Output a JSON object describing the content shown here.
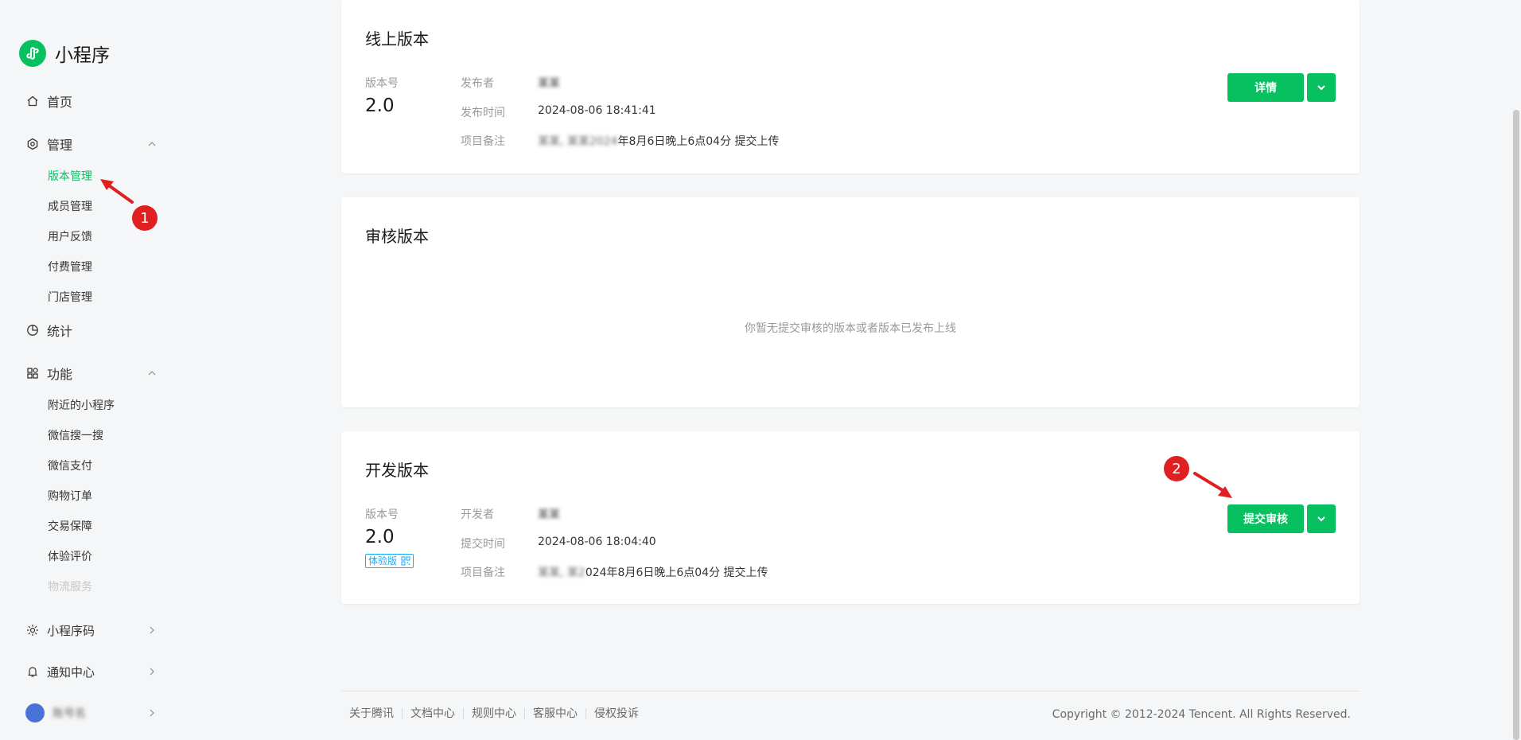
{
  "app": {
    "title": "小程序"
  },
  "sidebar": {
    "home": "首页",
    "manage": {
      "label": "管理",
      "items": [
        "版本管理",
        "成员管理",
        "用户反馈",
        "付费管理",
        "门店管理"
      ]
    },
    "stats": "统计",
    "features": {
      "label": "功能",
      "items": [
        "附近的小程序",
        "微信搜一搜",
        "微信支付",
        "购物订单",
        "交易保障",
        "体验评价",
        "物流服务"
      ]
    },
    "qrcode": "小程序码",
    "notify": "通知中心",
    "account_name": "账号名"
  },
  "online": {
    "title": "线上版本",
    "version_label": "版本号",
    "version": "2.0",
    "publisher_label": "发布者",
    "publisher": "某某",
    "time_label": "发布时间",
    "time": "2024-08-06 18:41:41",
    "note_label": "项目备注",
    "note_blur": "某某, 某某2024",
    "note_text": "年8月6日晚上6点04分 提交上传",
    "detail_button": "详情"
  },
  "review": {
    "title": "审核版本",
    "empty": "你暂无提交审核的版本或者版本已发布上线"
  },
  "dev": {
    "title": "开发版本",
    "version_label": "版本号",
    "version": "2.0",
    "badge": "体验版",
    "developer_label": "开发者",
    "developer": "某某",
    "time_label": "提交时间",
    "time": "2024-08-06 18:04:40",
    "note_label": "项目备注",
    "note_blur": "某某, 某2",
    "note_text": "024年8月6日晚上6点04分 提交上传",
    "submit_button": "提交审核"
  },
  "footer": {
    "links": [
      "关于腾讯",
      "文档中心",
      "规则中心",
      "客服中心",
      "侵权投诉"
    ],
    "copyright": "Copyright © 2012-2024 Tencent. All Rights Reserved."
  },
  "annotations": {
    "marker1": "1",
    "marker2": "2"
  },
  "colors": {
    "brand": "#07c160",
    "annotation": "#e02020",
    "badge": "#10aeff"
  }
}
